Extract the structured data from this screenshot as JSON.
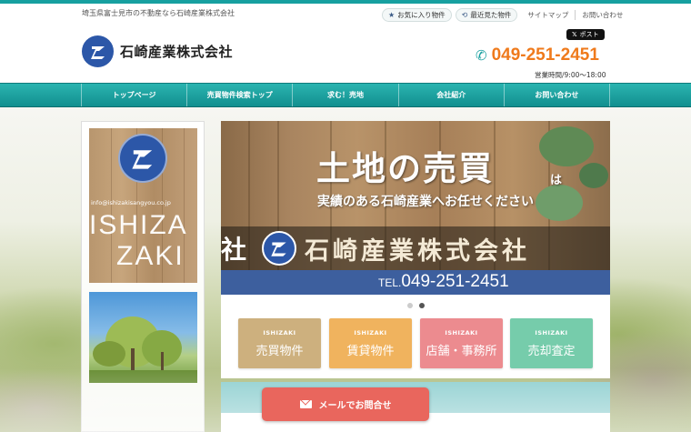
{
  "header": {
    "tagline": "埼玉県富士見市の不動産なら石崎産業株式会社",
    "favorites_label": "お気に入り物件",
    "recent_label": "最近見た物件",
    "sitemap_label": "サイトマップ",
    "contact_link_label": "お問い合わせ",
    "company_name": "石崎産業株式会社",
    "share_label": "ポスト",
    "phone": "049-251-2451",
    "hours": "営業時間/9:00～18:00"
  },
  "nav": {
    "items": [
      {
        "label": "トップページ"
      },
      {
        "label": "売買物件検索トップ"
      },
      {
        "label": "求む！売地"
      },
      {
        "label": "会社紹介"
      },
      {
        "label": "お問い合わせ"
      }
    ]
  },
  "sidebar": {
    "email": "info@ishizakisangyou.co.jp",
    "big_text_1": "ISHIZA",
    "big_text_2": "ZAKI"
  },
  "slider": {
    "title": "土地の売買",
    "title_suffix": "は",
    "subtitle": "実績のある石崎産業へお任せください",
    "band_left": "社",
    "band_company": "石崎産業株式会社",
    "tel_prefix": "TEL.",
    "tel": "049-251-2451",
    "active_dot": 1
  },
  "categories": [
    {
      "en": "ISHIZAKI",
      "jp": "売買物件",
      "color": "#cdb07e"
    },
    {
      "en": "ISHIZAKI",
      "jp": "賃貸物件",
      "color": "#f0b35e"
    },
    {
      "en": "ISHIZAKI",
      "jp": "店舗・事務所",
      "color": "#ec8b8f"
    },
    {
      "en": "ISHIZAKI",
      "jp": "売却査定",
      "color": "#76ccab"
    }
  ],
  "mail_button": {
    "label": "メールでお問合せ"
  },
  "colors": {
    "teal": "#17a0a0",
    "brand_blue": "#2c57a8",
    "phone_orange": "#ef7a1c",
    "mail_red": "#e9665d"
  }
}
